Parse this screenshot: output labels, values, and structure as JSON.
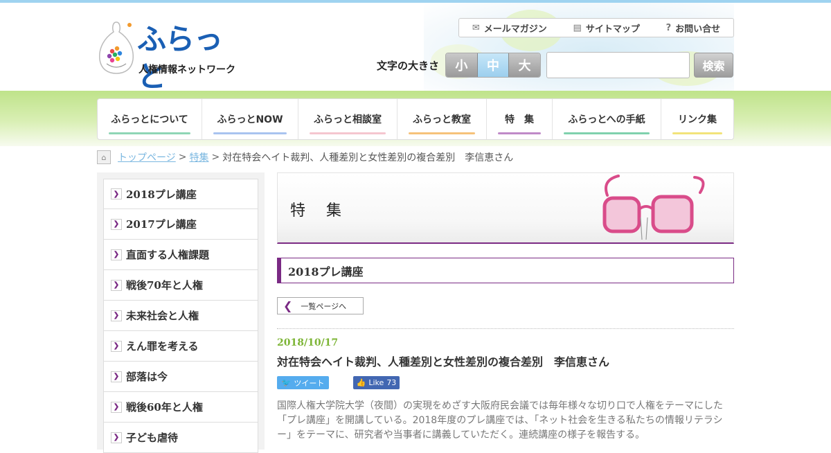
{
  "header": {
    "logo_text": "ふらっと",
    "logo_sub": "人権情報ネットワーク",
    "util_links": [
      {
        "label": "メールマガジン",
        "icon": "mail-icon"
      },
      {
        "label": "サイトマップ",
        "icon": "sitemap-icon"
      },
      {
        "label": "お問い合せ",
        "icon": "question-icon"
      }
    ],
    "font_size_label": "文字の大きさ",
    "font_sizes": [
      "小",
      "中",
      "大"
    ],
    "active_font_size": "中",
    "search_value": "",
    "search_button": "検索"
  },
  "nav": {
    "items": [
      {
        "label": "ふらっとについて",
        "color": "#8fd6b5"
      },
      {
        "label": "ふらっとNOW",
        "color": "#a9c3ef"
      },
      {
        "label": "ふらっと相談室",
        "color": "#f5c6cf"
      },
      {
        "label": "ふらっと教室",
        "color": "#f6c27a"
      },
      {
        "label": "特　集",
        "color": "#c08ac8"
      },
      {
        "label": "ふらっとへの手紙",
        "color": "#7fd1ad"
      },
      {
        "label": "リンク集",
        "color": "#f2e37a"
      }
    ]
  },
  "breadcrumb": {
    "home": "トップページ",
    "section": "特集",
    "sep": ">",
    "current": "対在特会ヘイト裁判、人種差別と女性差別の複合差別　李信恵さん"
  },
  "sidebar": {
    "items": [
      "2018プレ講座",
      "2017プレ講座",
      "直面する人権課題",
      "戦後70年と人権",
      "未来社会と人権",
      "えん罪を考える",
      "部落は今",
      "戦後60年と人権",
      "子ども虐待"
    ]
  },
  "main": {
    "banner_title": "特　集",
    "section_heading": "2018プレ講座",
    "back_label": "一覧ページへ",
    "post": {
      "date": "2018/10/17",
      "title": "対在特会ヘイト裁判、人種差別と女性差別の複合差別　李信恵さん",
      "tweet_label": "ツイート",
      "like_label": "Like",
      "like_count": "73",
      "body": "国際人権大学院大学（夜間）の実現をめざす大阪府民会議では毎年様々な切り口で人権をテーマにした「プレ講座」を開講している。2018年度のプレ講座では、「ネット社会を生きる私たちの情報リテラシー」をテーマに、研究者や当事者に講義していただく。連続講座の様子を報告する。"
    }
  },
  "colors": {
    "accent": "#7a2a84",
    "date": "#7db536",
    "link": "#7ab7e0",
    "band": "#bfe38a"
  }
}
